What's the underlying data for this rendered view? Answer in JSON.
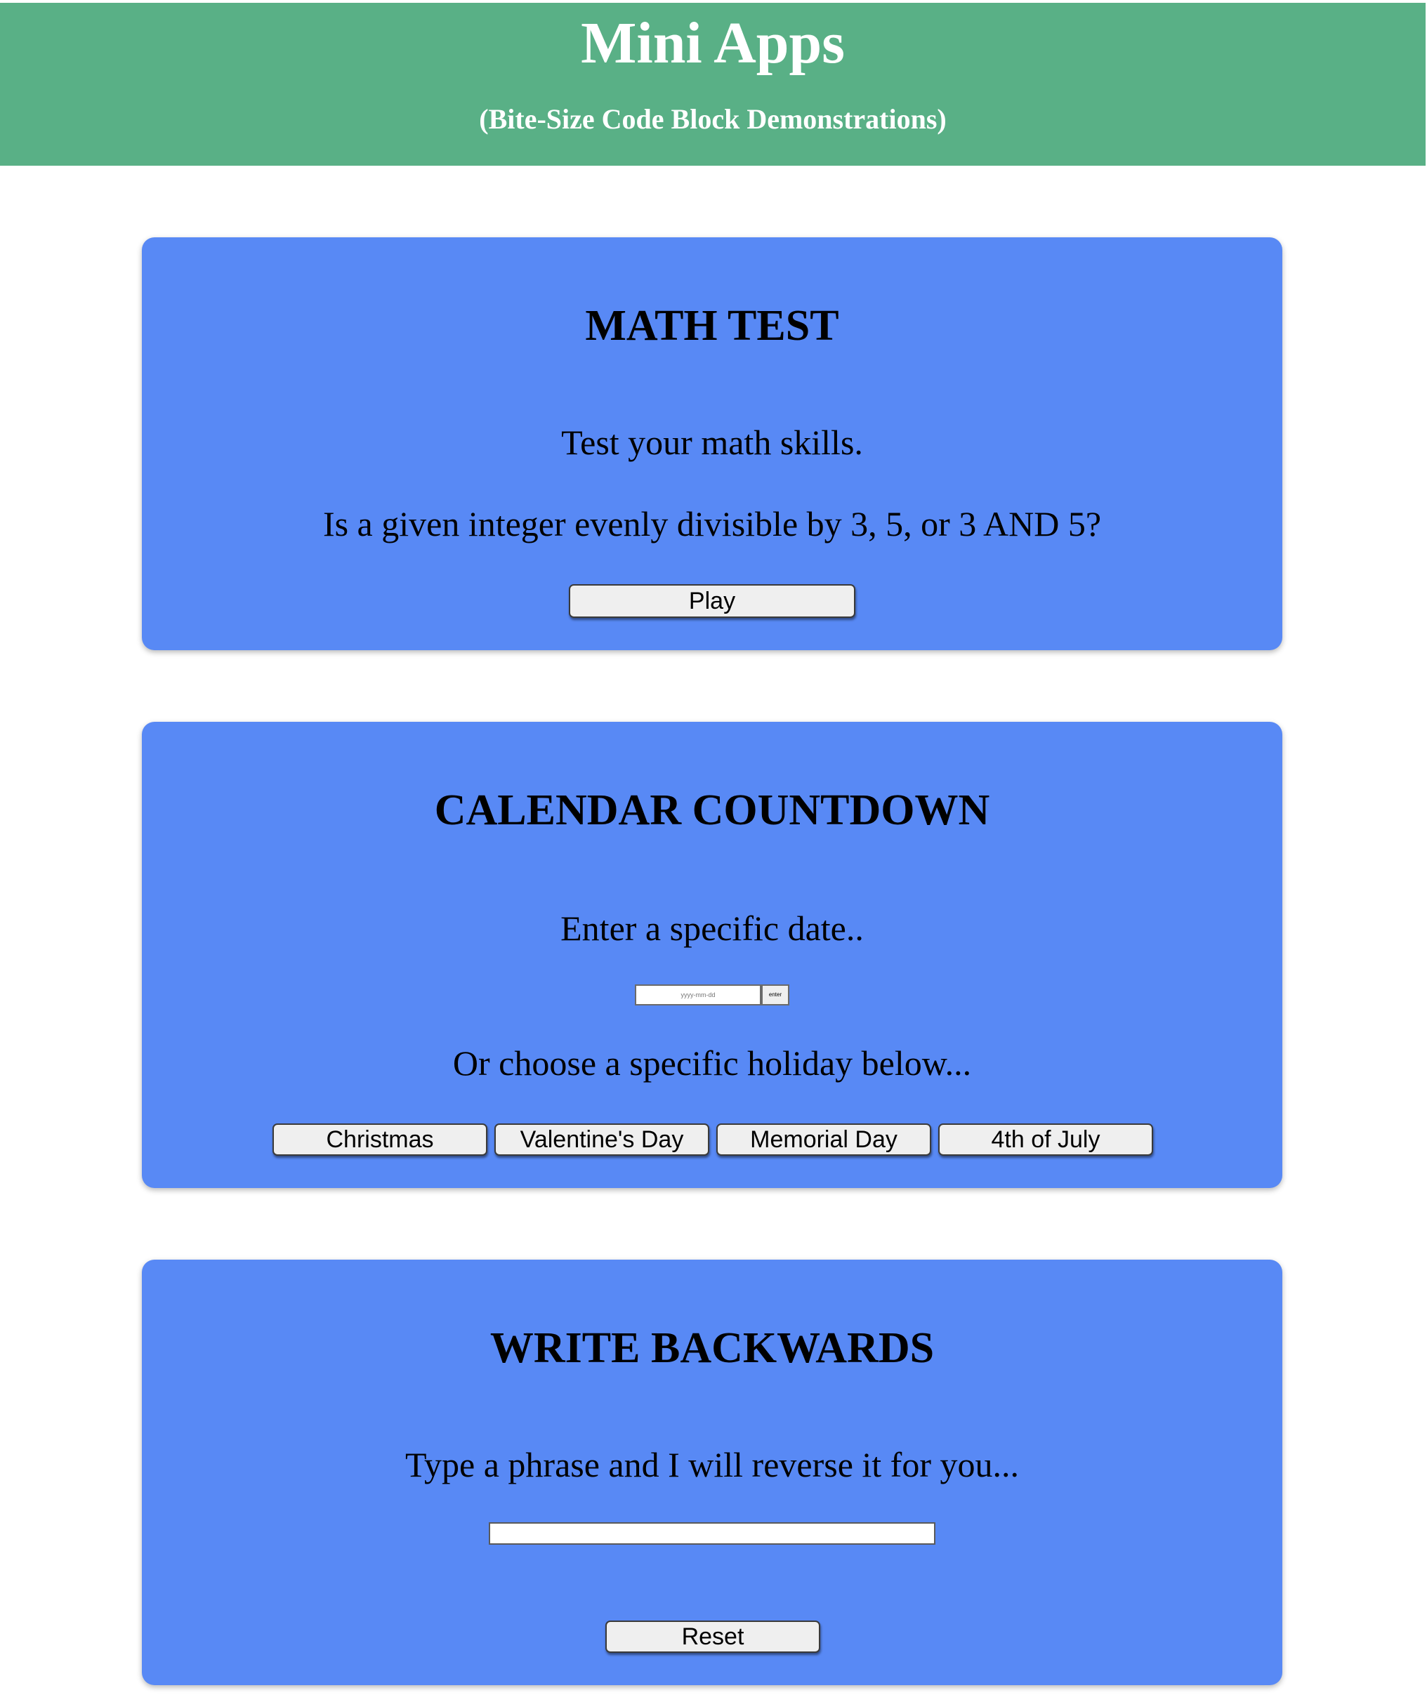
{
  "header": {
    "title": "Mini Apps",
    "subtitle": "(Bite-Size Code Block Demonstrations)"
  },
  "math_test": {
    "title": "MATH TEST",
    "line1": "Test your math skills.",
    "line2": "Is a given integer evenly divisible by 3, 5, or 3 AND 5?",
    "play_label": "Play"
  },
  "calendar": {
    "title": "CALENDAR COUNTDOWN",
    "prompt": "Enter a specific date..",
    "date_placeholder": "yyyy-mm-dd",
    "enter_label": "enter",
    "holiday_prompt": "Or choose a specific holiday below...",
    "holidays": [
      {
        "label": "Christmas"
      },
      {
        "label": "Valentine's Day"
      },
      {
        "label": "Memorial Day"
      },
      {
        "label": "4th of July"
      }
    ]
  },
  "write_backwards": {
    "title": "WRITE BACKWARDS",
    "prompt": "Type a phrase and I will reverse it for you...",
    "input_value": "",
    "reset_label": "Reset"
  }
}
